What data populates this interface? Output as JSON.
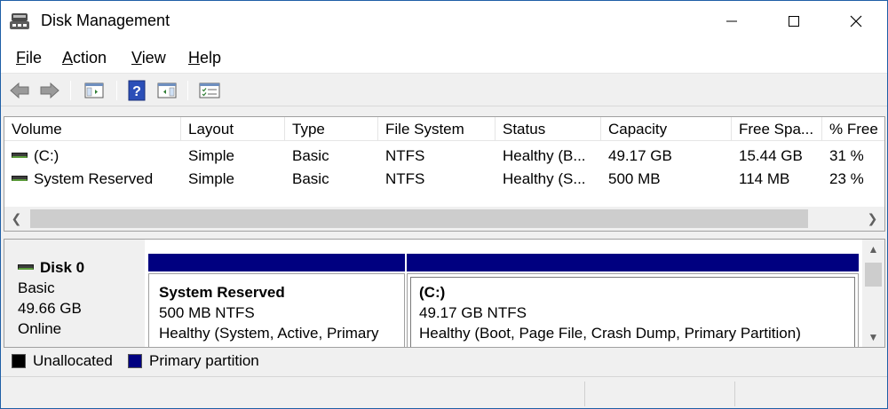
{
  "window": {
    "title": "Disk Management"
  },
  "menu": [
    {
      "label": "File",
      "key": "F",
      "rest": "ile"
    },
    {
      "label": "Action",
      "key": "A",
      "rest": "ction"
    },
    {
      "label": "View",
      "key": "V",
      "rest": "iew"
    },
    {
      "label": "Help",
      "key": "H",
      "rest": "elp"
    }
  ],
  "toolbar": [
    "back-icon",
    "forward-icon",
    "show-hide-console-tree-icon",
    "help-icon",
    "show-hide-action-pane-icon",
    "properties-icon"
  ],
  "volumes": {
    "columns": [
      "Volume",
      "Layout",
      "Type",
      "File System",
      "Status",
      "Capacity",
      "Free Spa...",
      "% Free"
    ],
    "rows": [
      {
        "volume": "(C:)",
        "layout": "Simple",
        "type": "Basic",
        "fs": "NTFS",
        "status": "Healthy (B...",
        "capacity": "49.17 GB",
        "free": "15.44 GB",
        "pct": "31 %"
      },
      {
        "volume": "System Reserved",
        "layout": "Simple",
        "type": "Basic",
        "fs": "NTFS",
        "status": "Healthy (S...",
        "capacity": "500 MB",
        "free": "114 MB",
        "pct": "23 %"
      }
    ]
  },
  "disk": {
    "name": "Disk 0",
    "type": "Basic",
    "size": "49.66 GB",
    "state": "Online",
    "partitions": [
      {
        "name": "System Reserved",
        "size": "500 MB NTFS",
        "status": "Healthy (System, Active, Primary"
      },
      {
        "name": "(C:)",
        "size": "49.17 GB NTFS",
        "status": "Healthy (Boot, Page File, Crash Dump, Primary Partition)"
      }
    ]
  },
  "legend": {
    "unallocated": "Unallocated",
    "primary": "Primary partition"
  },
  "colors": {
    "primary": "#000080",
    "unallocated": "#000000",
    "titlebar": "#ffffff"
  }
}
